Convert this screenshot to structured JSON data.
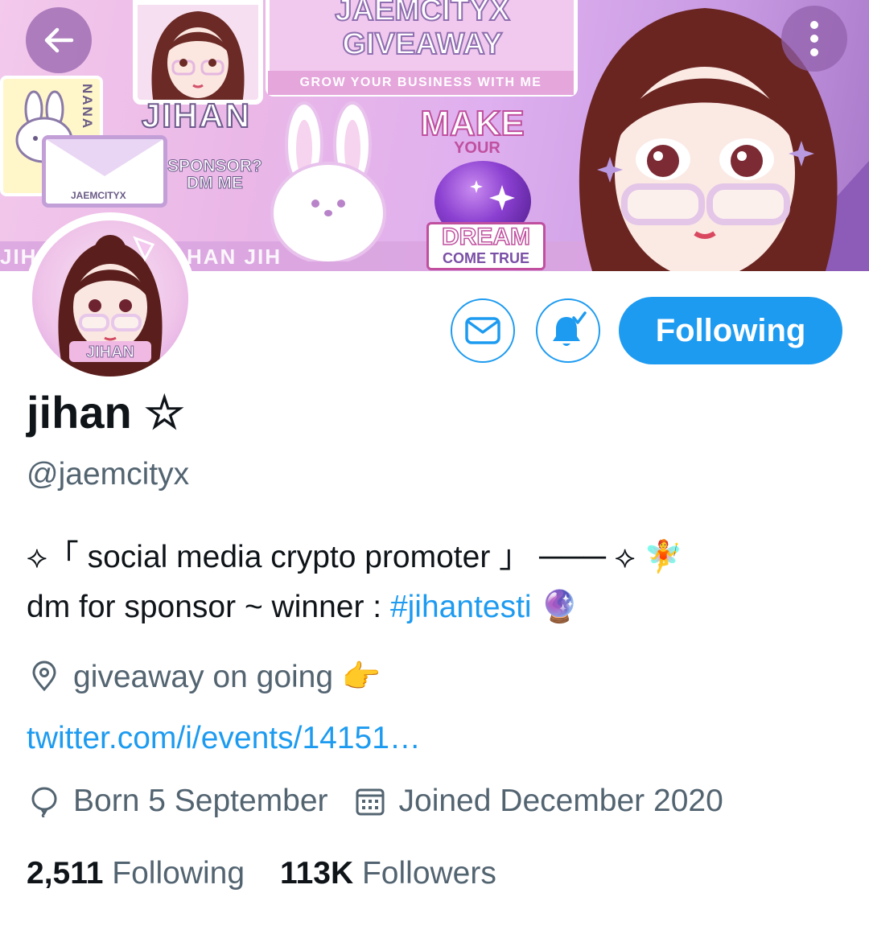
{
  "banner": {
    "giveaway_title": "JAEMCITYX GIVEAWAY",
    "tagline": "GROW YOUR BUSINESS WITH ME",
    "name_art": "JIHAN",
    "sponsor_line1": "SPONSOR?",
    "sponsor_line2": "DM ME",
    "nana": "NANA",
    "envelope_label": "JAEMCITYX",
    "make": "MAKE",
    "your": "YOUR",
    "dream": "DREAM",
    "come_true": "COME TRUE",
    "stripe_left": "JIH",
    "stripe_mid": "HAN JIH"
  },
  "avatar": {
    "badge_text": "JIHAN"
  },
  "actions": {
    "follow_label": "Following"
  },
  "profile": {
    "display_name": "jihan ☆",
    "handle": "@jaemcityx",
    "bio_line1": "⟡「 social media crypto promoter 」 ─── ⟡ 🧚",
    "bio_line2_prefix": "dm for sponsor ~ winner : ",
    "bio_hashtag": "#jihantesti",
    "bio_line2_suffix": " 🔮",
    "location": "giveaway on going 👉",
    "link": "twitter.com/i/events/14151…",
    "born": "Born 5 September",
    "joined": "Joined December 2020"
  },
  "stats": {
    "following_count": "2,511",
    "following_label": "Following",
    "followers_count": "113K",
    "followers_label": "Followers"
  },
  "colors": {
    "accent": "#1d9bf0",
    "text": "#0f1419",
    "secondary": "#536471"
  }
}
